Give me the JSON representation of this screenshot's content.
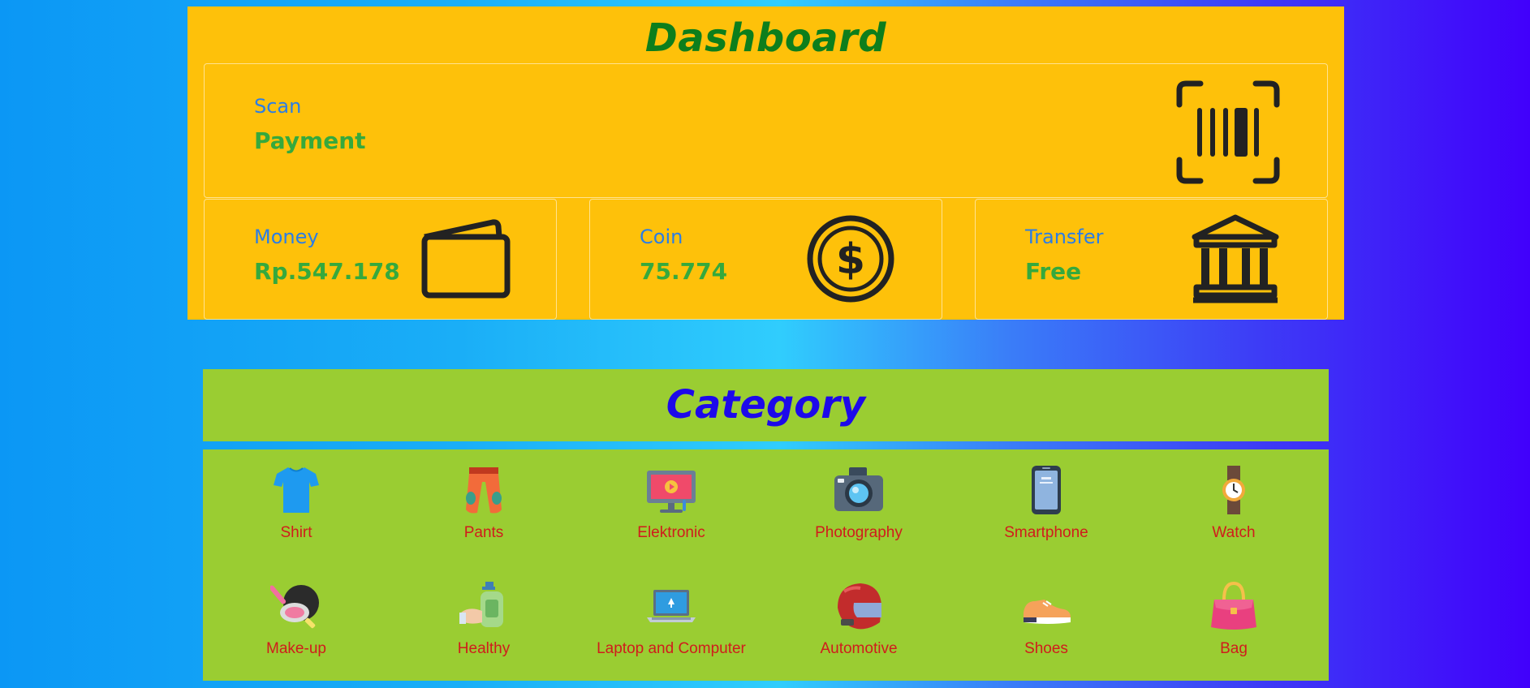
{
  "dashboard": {
    "title": "Dashboard",
    "scan": {
      "label": "Scan",
      "value": "Payment",
      "icon": "barcode-scan-icon"
    },
    "cards": [
      {
        "label": "Money",
        "value": "Rp.547.178",
        "icon": "wallet-icon"
      },
      {
        "label": "Coin",
        "value": "75.774",
        "icon": "dollar-coin-icon"
      },
      {
        "label": "Transfer",
        "value": "Free",
        "icon": "bank-icon"
      }
    ]
  },
  "category": {
    "title": "Category",
    "items": [
      {
        "label": "Shirt",
        "icon": "shirt-icon"
      },
      {
        "label": "Pants",
        "icon": "pants-icon"
      },
      {
        "label": "Elektronic",
        "icon": "monitor-icon"
      },
      {
        "label": "Photography",
        "icon": "camera-icon"
      },
      {
        "label": "Smartphone",
        "icon": "smartphone-icon"
      },
      {
        "label": "Watch",
        "icon": "watch-icon"
      },
      {
        "label": "Make-up",
        "icon": "makeup-icon"
      },
      {
        "label": "Healthy",
        "icon": "hand-sanitizer-icon"
      },
      {
        "label": "Laptop and Computer",
        "icon": "laptop-icon"
      },
      {
        "label": "Automotive",
        "icon": "helmet-icon"
      },
      {
        "label": "Shoes",
        "icon": "sneaker-icon"
      },
      {
        "label": "Bag",
        "icon": "handbag-icon"
      }
    ]
  },
  "colors": {
    "dashboard_bg": "#fec10a",
    "dashboard_title": "#0d7e1c",
    "card_label": "#2b7de6",
    "card_value": "#35a93d",
    "category_bg": "#9acd32",
    "category_title": "#1d09ea",
    "category_label": "#d01c1c"
  }
}
